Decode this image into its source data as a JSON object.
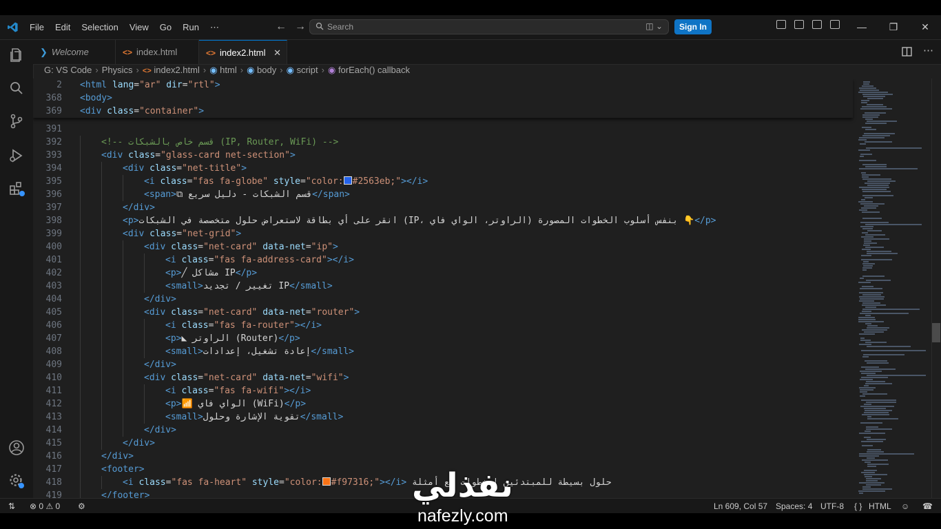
{
  "menu": [
    "File",
    "Edit",
    "Selection",
    "View",
    "Go",
    "Run",
    "⋯"
  ],
  "search": {
    "placeholder": "Search"
  },
  "sign_in": "Sign In",
  "tabs": [
    {
      "label": "Welcome",
      "icon": "vscode-icon"
    },
    {
      "label": "index.html",
      "icon": "html-icon"
    },
    {
      "label": "index2.html",
      "icon": "html-icon",
      "close": "✕"
    }
  ],
  "breadcrumb": [
    "G:",
    "VS Code",
    "Physics",
    "index2.html",
    "html",
    "body",
    "script",
    "forEach() callback"
  ],
  "sticky": [
    {
      "n": "2",
      "html": "<span class=\"tag\">&lt;html</span> <span class=\"attr\">lang</span>=<span class=\"str\">\"ar\"</span> <span class=\"attr\">dir</span>=<span class=\"str\">\"rtl\"</span><span class=\"tag\">&gt;</span>"
    },
    {
      "n": "368",
      "html": "<span class=\"tag\">&lt;body&gt;</span>"
    },
    {
      "n": "369",
      "html": "<span class=\"tag\">&lt;div</span> <span class=\"attr\">class</span>=<span class=\"str\">\"container\"</span><span class=\"tag\">&gt;</span>"
    }
  ],
  "lines": [
    {
      "n": "391",
      "indent": 0,
      "html": ""
    },
    {
      "n": "392",
      "indent": 1,
      "html": "<span class=\"cmt\">&lt;!-- قسم خاص بالشبكات (IP, Router, WiFi) --&gt;</span>"
    },
    {
      "n": "393",
      "indent": 1,
      "html": "<span class=\"tag\">&lt;div</span> <span class=\"attr\">class</span>=<span class=\"str\">\"glass-card net-section\"</span><span class=\"tag\">&gt;</span>"
    },
    {
      "n": "394",
      "indent": 2,
      "html": "<span class=\"tag\">&lt;div</span> <span class=\"attr\">class</span>=<span class=\"str\">\"net-title\"</span><span class=\"tag\">&gt;</span>"
    },
    {
      "n": "395",
      "indent": 3,
      "html": "<span class=\"tag\">&lt;i</span> <span class=\"attr\">class</span>=<span class=\"str\">\"fas fa-globe\"</span> <span class=\"attr\">style</span>=<span class=\"str\">\"color:<span class=\"swatch\" style=\"background:#2563eb\"></span>#2563eb;\"</span><span class=\"tag\">&gt;&lt;/i&gt;</span>"
    },
    {
      "n": "396",
      "indent": 3,
      "html": "<span class=\"tag\">&lt;span&gt;</span><span class=\"txt\">⧉ قسم الشبكات - دليل سريع</span><span class=\"tag\">&lt;/span&gt;</span>"
    },
    {
      "n": "397",
      "indent": 2,
      "html": "<span class=\"tag\">&lt;/div&gt;</span>"
    },
    {
      "n": "398",
      "indent": 2,
      "html": "<span class=\"tag\">&lt;p&gt;</span><span class=\"txt\">انقر على أي بطاقة لاستعراض حلول متخصصة في الشبكات (IP، الراوتر، الواي فاي) بنفس أسلوب الخطوات المصورة 👇</span><span class=\"tag\">&lt;/p&gt;</span>"
    },
    {
      "n": "399",
      "indent": 2,
      "html": "<span class=\"tag\">&lt;div</span> <span class=\"attr\">class</span>=<span class=\"str\">\"net-grid\"</span><span class=\"tag\">&gt;</span>"
    },
    {
      "n": "400",
      "indent": 3,
      "html": "<span class=\"tag\">&lt;div</span> <span class=\"attr\">class</span>=<span class=\"str\">\"net-card\"</span> <span class=\"attr\">data-net</span>=<span class=\"str\">\"ip\"</span><span class=\"tag\">&gt;</span>"
    },
    {
      "n": "401",
      "indent": 4,
      "html": "<span class=\"tag\">&lt;i</span> <span class=\"attr\">class</span>=<span class=\"str\">\"fas fa-address-card\"</span><span class=\"tag\">&gt;&lt;/i&gt;</span>"
    },
    {
      "n": "402",
      "indent": 4,
      "html": "<span class=\"tag\">&lt;p&gt;</span><span class=\"txt\">╱ مشاكل IP</span><span class=\"tag\">&lt;/p&gt;</span>"
    },
    {
      "n": "403",
      "indent": 4,
      "html": "<span class=\"tag\">&lt;small&gt;</span><span class=\"txt\">تغيير / تجديد IP</span><span class=\"tag\">&lt;/small&gt;</span>"
    },
    {
      "n": "404",
      "indent": 3,
      "html": "<span class=\"tag\">&lt;/div&gt;</span>"
    },
    {
      "n": "405",
      "indent": 3,
      "html": "<span class=\"tag\">&lt;div</span> <span class=\"attr\">class</span>=<span class=\"str\">\"net-card\"</span> <span class=\"attr\">data-net</span>=<span class=\"str\">\"router\"</span><span class=\"tag\">&gt;</span>"
    },
    {
      "n": "406",
      "indent": 4,
      "html": "<span class=\"tag\">&lt;i</span> <span class=\"attr\">class</span>=<span class=\"str\">\"fas fa-router\"</span><span class=\"tag\">&gt;&lt;/i&gt;</span>"
    },
    {
      "n": "407",
      "indent": 4,
      "html": "<span class=\"tag\">&lt;p&gt;</span><span class=\"txt\">◣ الراوتر (Router)</span><span class=\"tag\">&lt;/p&gt;</span>"
    },
    {
      "n": "408",
      "indent": 4,
      "html": "<span class=\"tag\">&lt;small&gt;</span><span class=\"txt\">إعادة تشغيل، إعدادات</span><span class=\"tag\">&lt;/small&gt;</span>"
    },
    {
      "n": "409",
      "indent": 3,
      "html": "<span class=\"tag\">&lt;/div&gt;</span>"
    },
    {
      "n": "410",
      "indent": 3,
      "html": "<span class=\"tag\">&lt;div</span> <span class=\"attr\">class</span>=<span class=\"str\">\"net-card\"</span> <span class=\"attr\">data-net</span>=<span class=\"str\">\"wifi\"</span><span class=\"tag\">&gt;</span>"
    },
    {
      "n": "411",
      "indent": 4,
      "html": "<span class=\"tag\">&lt;i</span> <span class=\"attr\">class</span>=<span class=\"str\">\"fas fa-wifi\"</span><span class=\"tag\">&gt;&lt;/i&gt;</span>"
    },
    {
      "n": "412",
      "indent": 4,
      "html": "<span class=\"tag\">&lt;p&gt;</span><span class=\"txt\">📶 الواي فاي (WiFi)</span><span class=\"tag\">&lt;/p&gt;</span>"
    },
    {
      "n": "413",
      "indent": 4,
      "html": "<span class=\"tag\">&lt;small&gt;</span><span class=\"txt\">تقوية الإشارة وحلول</span><span class=\"tag\">&lt;/small&gt;</span>"
    },
    {
      "n": "414",
      "indent": 3,
      "html": "<span class=\"tag\">&lt;/div&gt;</span>"
    },
    {
      "n": "415",
      "indent": 2,
      "html": "<span class=\"tag\">&lt;/div&gt;</span>"
    },
    {
      "n": "416",
      "indent": 1,
      "html": "<span class=\"tag\">&lt;/div&gt;</span>"
    },
    {
      "n": "417",
      "indent": 1,
      "html": "<span class=\"tag\">&lt;footer&gt;</span>"
    },
    {
      "n": "418",
      "indent": 2,
      "html": "<span class=\"tag\">&lt;i</span> <span class=\"attr\">class</span>=<span class=\"str\">\"fas fa-heart\"</span> <span class=\"attr\">style</span>=<span class=\"str\">\"color:<span class=\"swatch\" style=\"background:#f97316\"></span>#f97316;\"</span><span class=\"tag\">&gt;&lt;/i&gt;</span> <span class=\"txt\">حلول بسيطة للمبتدئين | خطوات مع أمثلة</span>"
    },
    {
      "n": "419",
      "indent": 1,
      "html": "<span class=\"tag\">&lt;/footer&gt;</span>"
    }
  ],
  "status": {
    "errors": "0",
    "warnings": "0",
    "position": "Ln 609, Col 57",
    "spaces": "Spaces: 4",
    "encoding": "UTF-8",
    "language": "HTML"
  },
  "watermark": {
    "arabic": "نفذلي",
    "latin": "nafezly.com"
  },
  "colors": {
    "accent": "#0078d4",
    "swatch_blue": "#2563eb",
    "swatch_orange": "#f97316"
  }
}
